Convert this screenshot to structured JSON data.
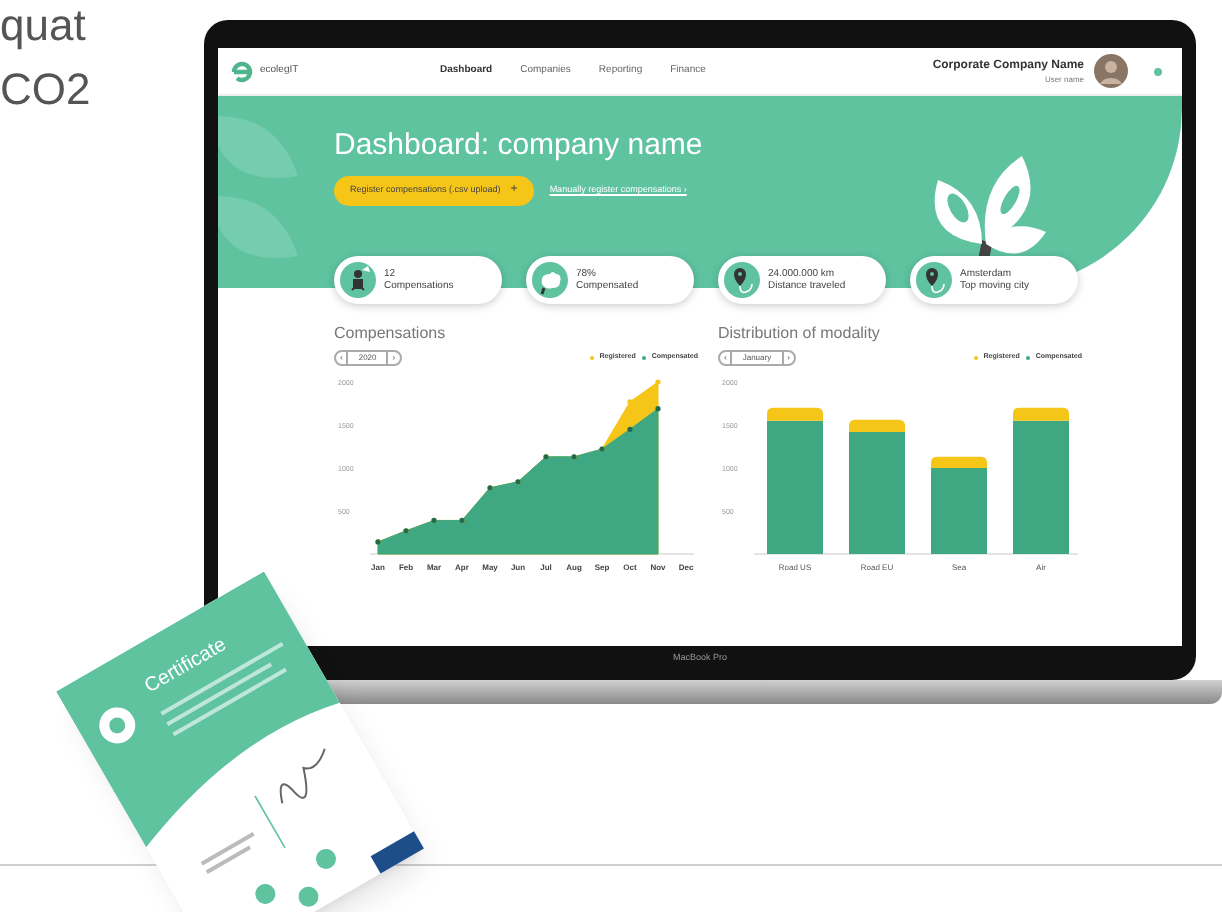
{
  "page_text": [
    "quat",
    "CO2"
  ],
  "laptop": {
    "label": "MacBook Pro",
    "nav": {
      "brand": "ecolegIT",
      "items": [
        {
          "label": "Dashboard",
          "selected": true
        },
        {
          "label": "Companies",
          "selected": false
        },
        {
          "label": "Reporting",
          "selected": false
        },
        {
          "label": "Finance",
          "selected": false
        }
      ],
      "company": "Corporate Company Name",
      "user": "User name"
    },
    "hero": {
      "title": "Dashboard: company name",
      "primary_button": "Register compensations (.csv upload)",
      "primary_button_icon": "+",
      "link": "Manually register compensations ›"
    },
    "stats": [
      {
        "value": "12",
        "label": "Compensations"
      },
      {
        "value": "78%",
        "label": "Compensated"
      },
      {
        "value": "24.000.000 km",
        "label": "Distance traveled"
      },
      {
        "value": "Amsterdam",
        "label": "Top moving city"
      }
    ],
    "charts": [
      {
        "title": "Compensations",
        "selector": {
          "prev": "‹",
          "value": "2020",
          "next": "›"
        },
        "chart_data": {
          "type": "area",
          "categories": [
            "Jan",
            "Feb",
            "Mar",
            "Apr",
            "May",
            "Jun",
            "Jul",
            "Aug",
            "Sep",
            "Oct",
            "Nov",
            "Dec"
          ],
          "yticks": [
            500,
            1000,
            1500,
            2000
          ],
          "ylim": [
            0,
            2000
          ],
          "series": [
            {
              "name": "Registered",
              "color": "#f5c518",
              "values": [
                140,
                270,
                390,
                390,
                770,
                840,
                1130,
                1130,
                1220,
                1770,
                2000,
                null
              ]
            },
            {
              "name": "Compensated",
              "color": "#3fa883",
              "values": [
                140,
                270,
                390,
                390,
                770,
                840,
                1130,
                1130,
                1220,
                1450,
                1690,
                null
              ]
            }
          ]
        }
      },
      {
        "title": "Distribution of modality",
        "selector": {
          "prev": "‹",
          "value": "January",
          "next": "›"
        },
        "chart_data": {
          "type": "bar",
          "stacked": true,
          "categories": [
            "Road US",
            "Road EU",
            "Sea",
            "Air"
          ],
          "yticks": [
            500,
            1000,
            1500,
            2000
          ],
          "ylim": [
            0,
            2000
          ],
          "series": [
            {
              "name": "Registered",
              "color": "#f5c518",
              "values": [
                150,
                140,
                130,
                150
              ]
            },
            {
              "name": "Compensated",
              "color": "#3fa883",
              "values": [
                1550,
                1420,
                1000,
                1550
              ]
            }
          ]
        }
      }
    ]
  },
  "certificate": {
    "title": "Certificate"
  }
}
